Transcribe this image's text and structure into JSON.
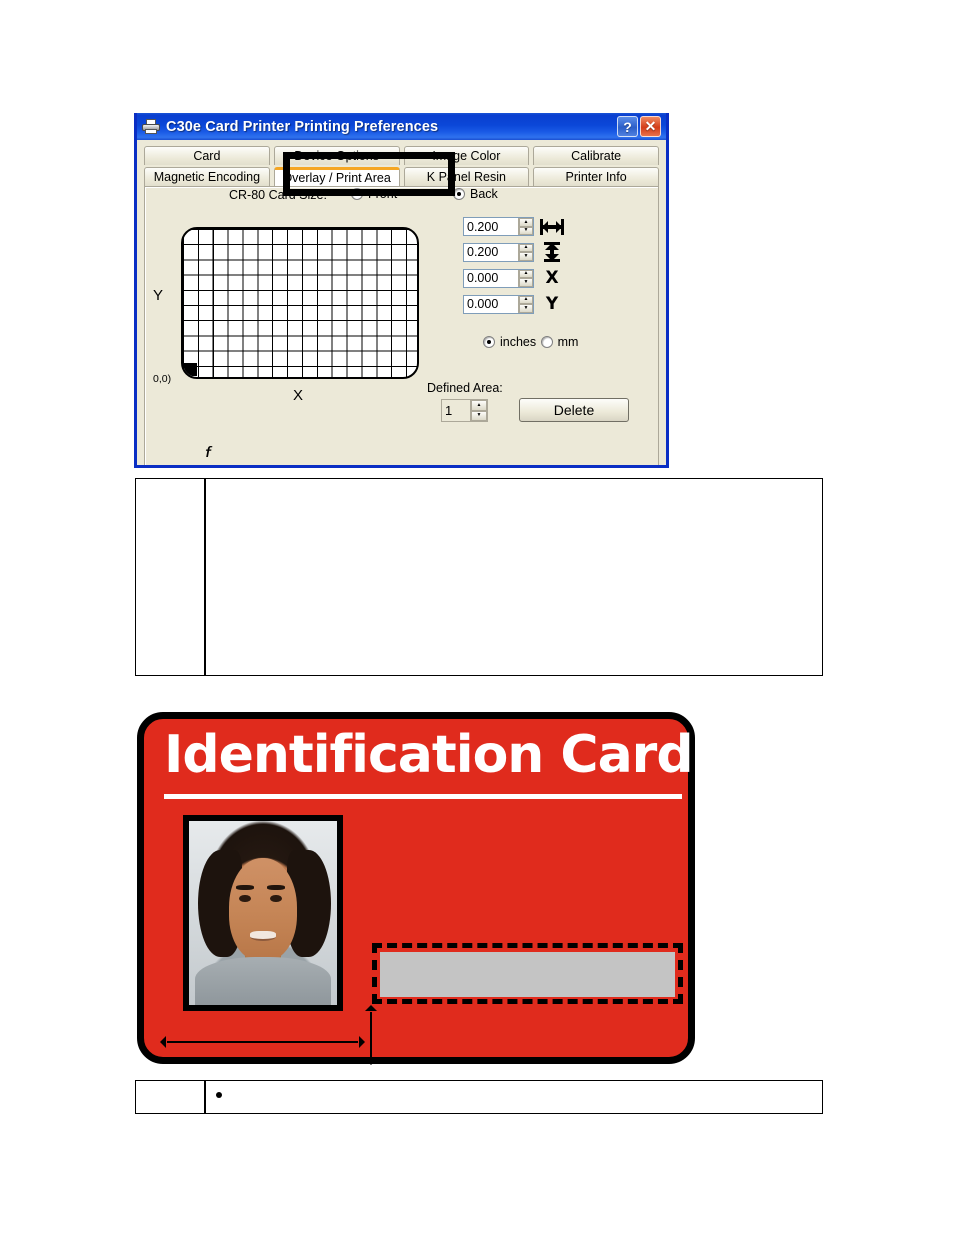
{
  "dialog": {
    "title": "C30e Card Printer Printing Preferences",
    "printer_icon": "printer-icon",
    "titlebar_buttons": {
      "help": "?",
      "close": "✕"
    },
    "accent_color": "#F5A623",
    "titlebar_color": "#0A3FD0",
    "face_color": "#ECE9D8",
    "tabs_row1": [
      {
        "label": "Card",
        "selected": false
      },
      {
        "label": "Device Options",
        "selected": false
      },
      {
        "label": "Image Color",
        "selected": false
      },
      {
        "label": "Calibrate",
        "selected": false
      }
    ],
    "tabs_row2": [
      {
        "label": "Magnetic Encoding",
        "selected": false
      },
      {
        "label": "Overlay / Print Area",
        "selected": true
      },
      {
        "label": "K Panel Resin",
        "selected": false
      },
      {
        "label": "Printer Info",
        "selected": false
      }
    ],
    "card_size": {
      "label": "CR-80 Card Size:",
      "options": [
        {
          "label": "Front",
          "checked": false
        },
        {
          "label": "Back",
          "checked": true
        }
      ]
    },
    "preview": {
      "axis_y": "Y",
      "axis_x": "X",
      "origin_label": "0,0)",
      "grid_cols": 16,
      "grid_rows": 10
    },
    "spinners": [
      {
        "value": "0.200",
        "icon": "width-icon"
      },
      {
        "value": "0.200",
        "icon": "height-icon"
      },
      {
        "value": "0.000",
        "icon": "x-icon",
        "glyph": "X"
      },
      {
        "value": "0.000",
        "icon": "y-icon",
        "glyph": "Y"
      }
    ],
    "units": [
      {
        "label": "inches",
        "checked": true
      },
      {
        "label": "mm",
        "checked": false
      }
    ],
    "defined_area": {
      "label": "Defined Area:",
      "value": "1",
      "delete_button": "Delete"
    },
    "spin_up": "▲",
    "spin_down": "▼"
  },
  "id_card": {
    "title": "Identification Card",
    "background_color": "#E02B1D",
    "title_color": "#FFFFFF",
    "gray_bar_color": "#C4C4C4",
    "photo_alt": "portrait-photo"
  },
  "tables": {
    "table1": {
      "rows": [
        {
          "col1": "",
          "col2": ""
        }
      ]
    },
    "table2": {
      "rows": [
        {
          "col1": "",
          "col2": "•"
        }
      ]
    }
  }
}
